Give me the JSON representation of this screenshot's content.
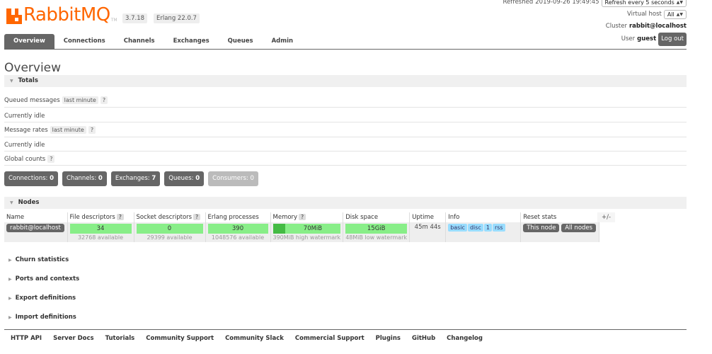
{
  "brand": {
    "name": "RabbitMQ",
    "tm": "TM",
    "version": "3.7.18",
    "erlang": "Erlang 22.0.7"
  },
  "status": {
    "refreshed_label": "Refreshed",
    "refreshed_time": "2019-09-26 19:49:45",
    "refresh_option": "Refresh every 5 seconds",
    "vhost_label": "Virtual host",
    "vhost_value": "All",
    "cluster_label": "Cluster",
    "cluster_value": "rabbit@localhost",
    "user_label": "User",
    "user_value": "guest",
    "logout_label": "Log out"
  },
  "tabs": [
    {
      "label": "Overview",
      "active": true
    },
    {
      "label": "Connections"
    },
    {
      "label": "Channels"
    },
    {
      "label": "Exchanges"
    },
    {
      "label": "Queues"
    },
    {
      "label": "Admin"
    }
  ],
  "page_title": "Overview",
  "totals": {
    "header": "Totals",
    "queued_label": "Queued messages",
    "queued_range": "last minute",
    "queued_help": "?",
    "queued_state": "Currently idle",
    "rates_label": "Message rates",
    "rates_range": "last minute",
    "rates_help": "?",
    "rates_state": "Currently idle",
    "global_label": "Global counts",
    "global_help": "?"
  },
  "counts": [
    {
      "label": "Connections:",
      "value": "0"
    },
    {
      "label": "Channels:",
      "value": "0"
    },
    {
      "label": "Exchanges:",
      "value": "7"
    },
    {
      "label": "Queues:",
      "value": "0"
    },
    {
      "label": "Consumers:",
      "value": "0"
    }
  ],
  "nodes": {
    "header": "Nodes",
    "columns": {
      "name": "Name",
      "fd": "File descriptors",
      "sock": "Socket descriptors",
      "erl": "Erlang processes",
      "mem": "Memory",
      "disk": "Disk space",
      "uptime": "Uptime",
      "info": "Info",
      "reset": "Reset stats",
      "help": "?",
      "plusminus": "+/-"
    },
    "row": {
      "name": "rabbit@localhost",
      "fd_used": "34",
      "fd_avail": "32768 available",
      "sock_used": "0",
      "sock_avail": "29399 available",
      "erl_used": "390",
      "erl_avail": "1048576 available",
      "mem_used": "70MiB",
      "mem_used_fraction": 0.18,
      "mem_watermark": "390MiB high watermark",
      "disk_free": "15GiB",
      "disk_watermark": "48MiB low watermark",
      "uptime": "45m 44s",
      "info_tags": [
        "basic",
        "disc",
        "1",
        "rss"
      ],
      "reset_this": "This node",
      "reset_all": "All nodes"
    }
  },
  "collapsed_sections": [
    "Churn statistics",
    "Ports and contexts",
    "Export definitions",
    "Import definitions"
  ],
  "footer": [
    "HTTP API",
    "Server Docs",
    "Tutorials",
    "Community Support",
    "Community Slack",
    "Commercial Support",
    "Plugins",
    "GitHub",
    "Changelog"
  ]
}
